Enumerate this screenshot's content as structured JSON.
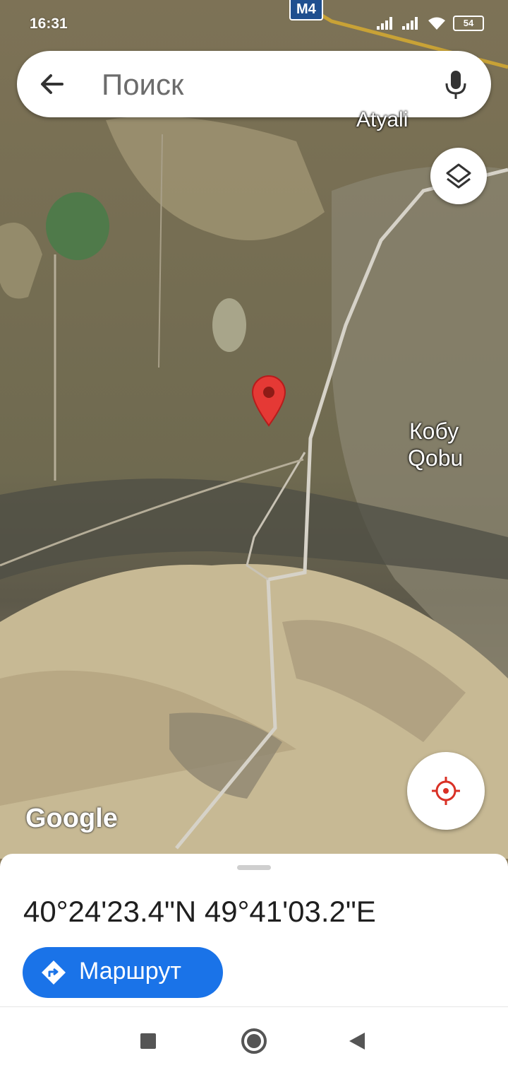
{
  "status_bar": {
    "time": "16:31",
    "battery": "54"
  },
  "map": {
    "road_shield": "M4",
    "labels": {
      "top_city": "Atyali",
      "city_ru": "Кобу",
      "city_az": "Qobu"
    },
    "attribution": "Google"
  },
  "search": {
    "placeholder": "Поиск"
  },
  "place": {
    "coordinates": "40°24'23.4\"N 49°41'03.2\"E"
  },
  "actions": {
    "route_label": "Маршрут"
  },
  "colors": {
    "accent": "#1a73e8",
    "pin": "#e53935",
    "location": "#d93025"
  }
}
